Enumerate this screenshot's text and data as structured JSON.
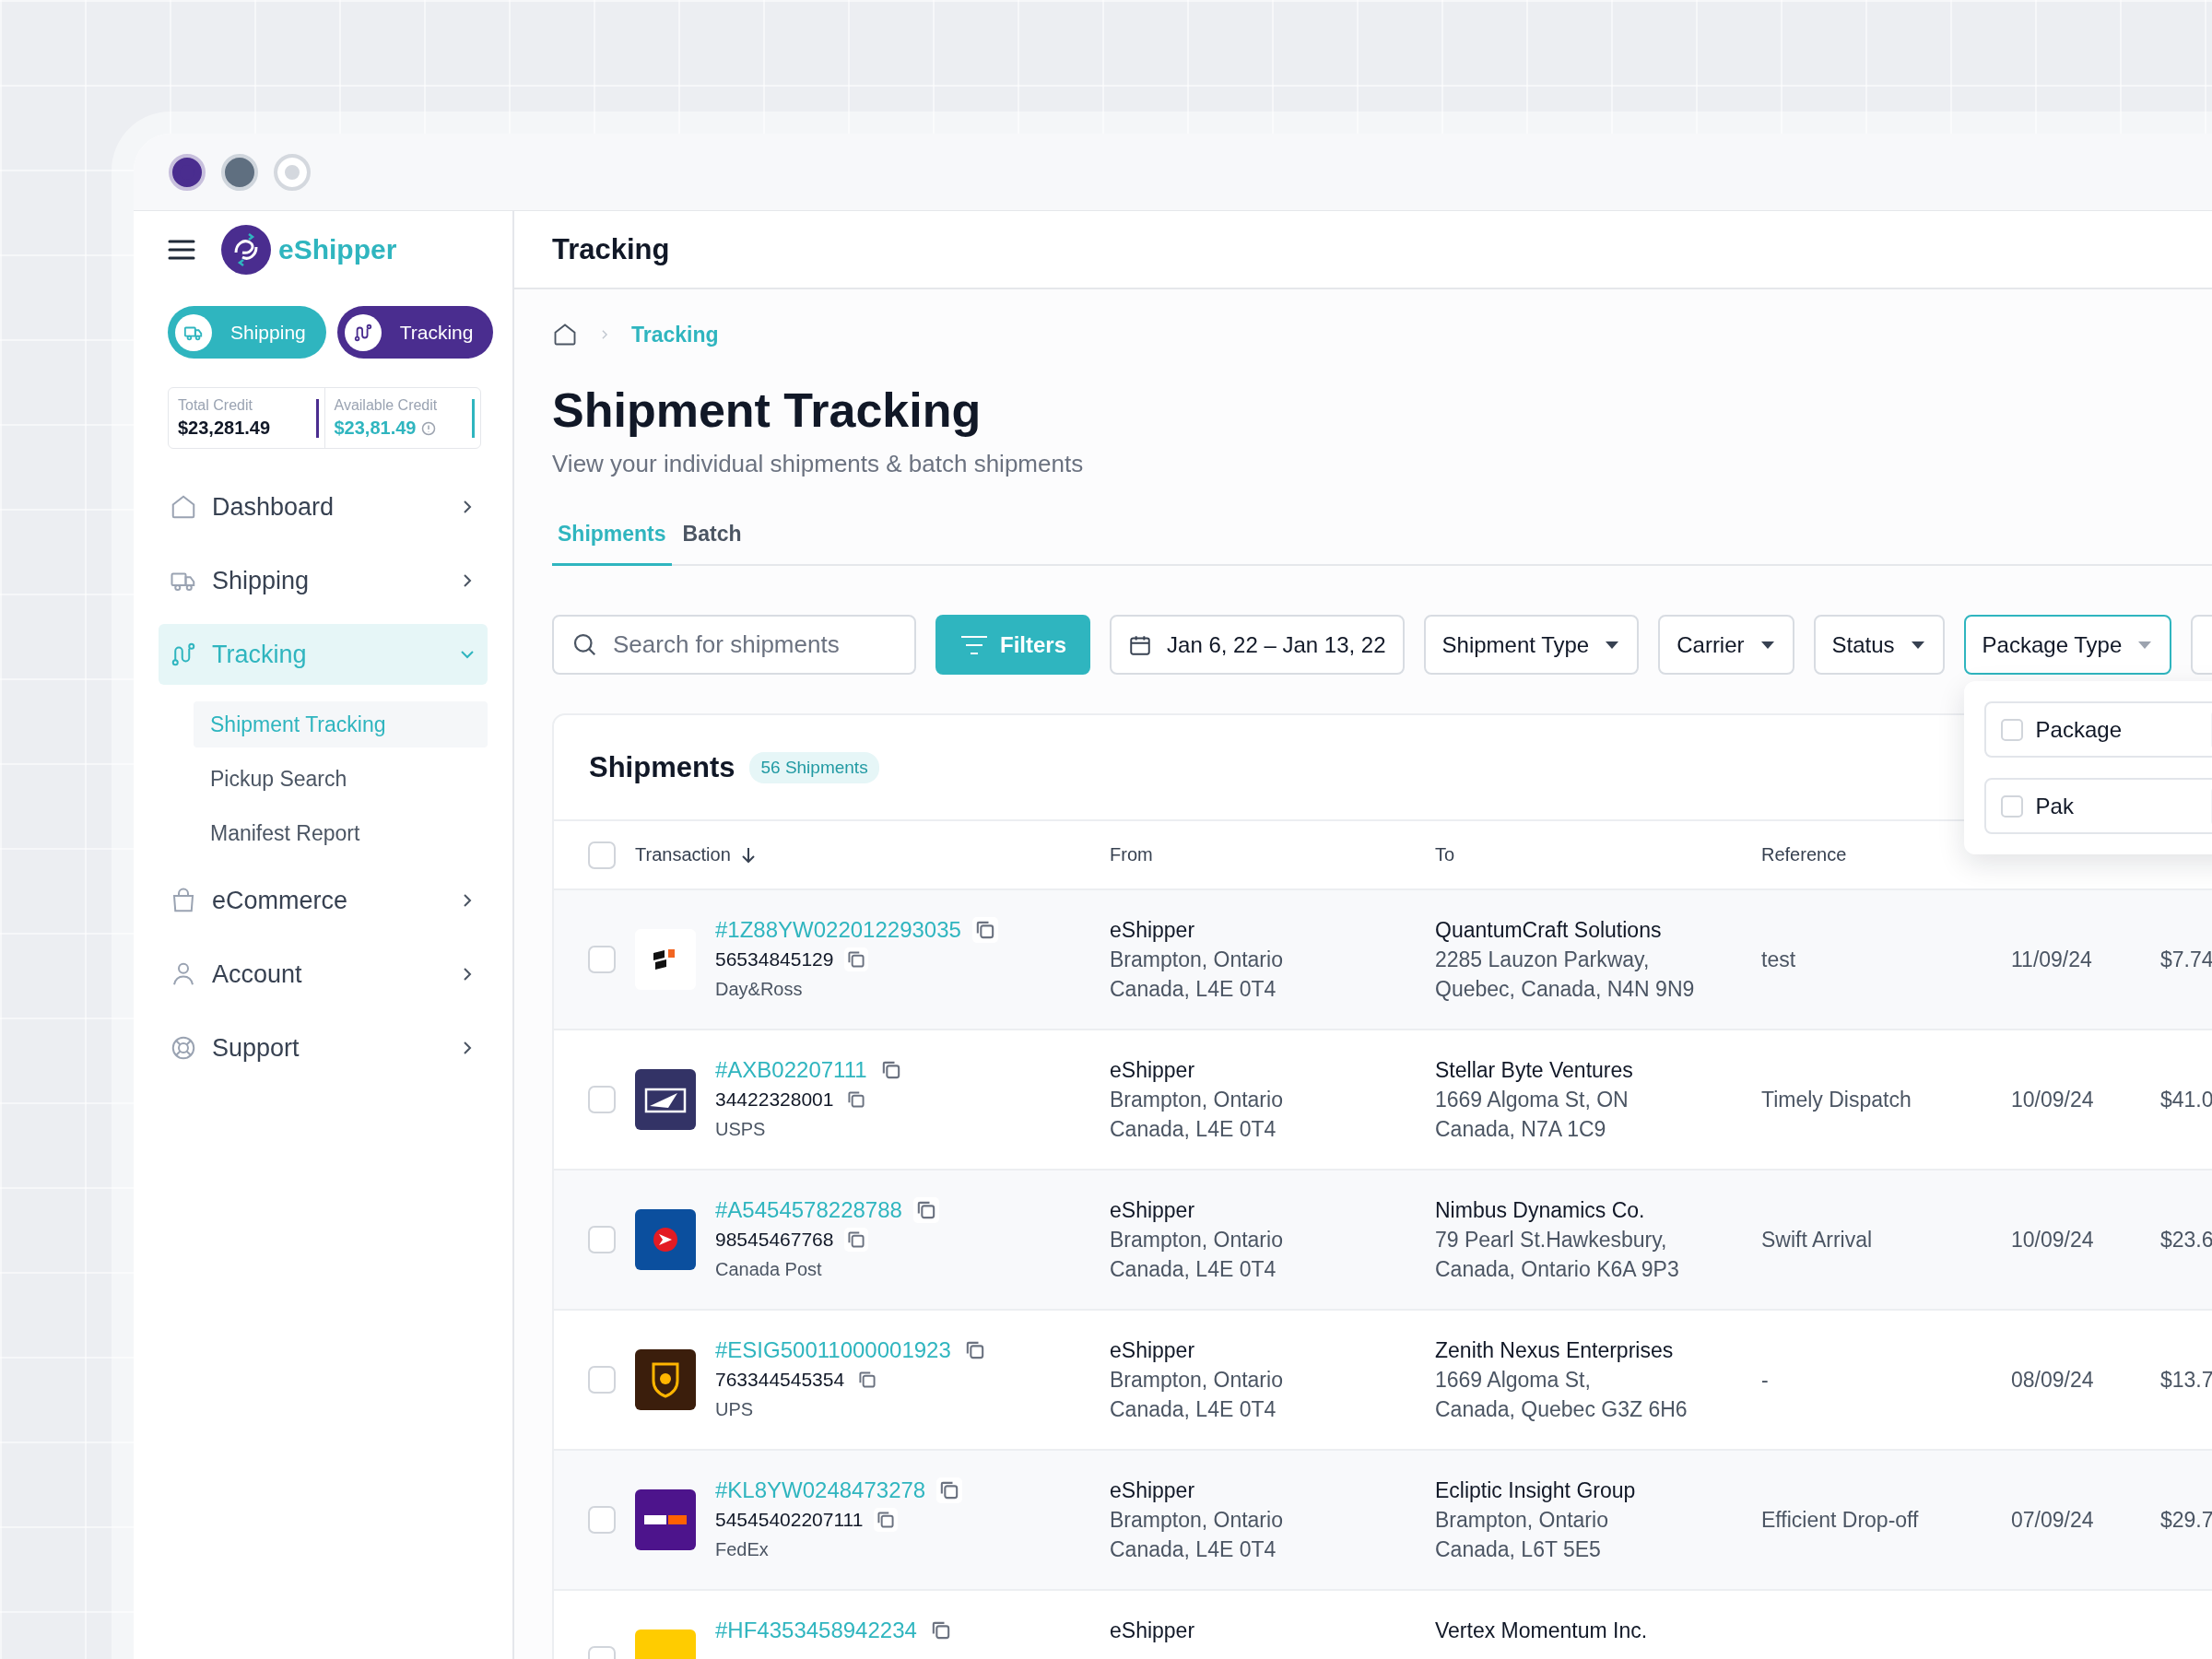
{
  "sidebar": {
    "brand": "eShipper",
    "quick_actions": [
      {
        "label": "Shipping",
        "color": "#2fb5bf"
      },
      {
        "label": "Tracking",
        "color": "#4a2d8f"
      }
    ],
    "credits": [
      {
        "label": "Total Credit",
        "value": "$23,281.49",
        "kind": "total"
      },
      {
        "label": "Available Credit",
        "value": "$23,81.49",
        "kind": "available"
      }
    ],
    "nav": [
      {
        "label": "Dashboard",
        "selected": false,
        "expanded": false
      },
      {
        "label": "Shipping",
        "selected": false,
        "expanded": false
      },
      {
        "label": "Tracking",
        "selected": true,
        "expanded": true,
        "children": [
          {
            "label": "Shipment Tracking",
            "selected": true
          },
          {
            "label": "Pickup Search",
            "selected": false
          },
          {
            "label": "Manifest Report",
            "selected": false
          }
        ]
      },
      {
        "label": "eCommerce",
        "selected": false,
        "expanded": false
      },
      {
        "label": "Account",
        "selected": false,
        "expanded": false
      },
      {
        "label": "Support",
        "selected": false,
        "expanded": false
      }
    ]
  },
  "header": {
    "title": "Tracking"
  },
  "breadcrumb": [
    {
      "label": "Tracking"
    }
  ],
  "page": {
    "title": "Shipment Tracking",
    "subtitle": "View your individual shipments & batch shipments"
  },
  "tabs": [
    {
      "label": "Shipments",
      "selected": true
    },
    {
      "label": "Batch",
      "selected": false
    }
  ],
  "filters": {
    "search": {
      "placeholder": "Search for shipments"
    },
    "filters_button": "Filters",
    "date_range": "Jan 6, 22 – Jan 13, 22",
    "dropdowns": [
      {
        "label": "Shipment Type",
        "open": false
      },
      {
        "label": "Carrier",
        "open": false
      },
      {
        "label": "Status",
        "open": false
      },
      {
        "label": "Package Type",
        "open": true
      }
    ],
    "menu_options": [
      {
        "label": "Package",
        "checked": false
      },
      {
        "label": "Pak",
        "checked": false
      }
    ]
  },
  "table": {
    "title": "Shipments",
    "count": "56 Shipments",
    "all_selected": false,
    "columns": [
      {
        "label": "Transaction",
        "sorted": true
      },
      {
        "label": "From"
      },
      {
        "label": "To"
      },
      {
        "label": "Reference"
      }
    ],
    "rows": [
      {
        "selected": false,
        "transaction": "#1Z88YW022012293035",
        "tracking": "56534845129",
        "carrier": "Day&Ross",
        "from": [
          "eShipper",
          "Brampton, Ontario",
          "Canada, L4E 0T4"
        ],
        "to": [
          "QuantumCraft Solutions",
          "2285 Lauzon Parkway,",
          "Quebec, Canada, N4N 9N9"
        ],
        "reference": "test",
        "ship_date": "11/09/24",
        "price": "$7.74"
      },
      {
        "selected": false,
        "transaction": "#AXB02207111",
        "tracking": "34422328001",
        "carrier": "USPS",
        "from": [
          "eShipper",
          "Brampton, Ontario",
          "Canada, L4E 0T4"
        ],
        "to": [
          "Stellar Byte Ventures",
          "1669 Algoma St, ON",
          "Canada, N7A 1C9"
        ],
        "reference": "Timely Dispatch",
        "ship_date": "10/09/24",
        "price": "$41.0"
      },
      {
        "selected": false,
        "transaction": "#A5454578228788",
        "tracking": "98545467768",
        "carrier": "Canada Post",
        "from": [
          "eShipper",
          "Brampton, Ontario",
          "Canada, L4E 0T4"
        ],
        "to": [
          "Nimbus Dynamics Co.",
          "79 Pearl St.Hawkesbury,",
          "Canada, Ontario K6A 9P3"
        ],
        "reference": "Swift Arrival",
        "ship_date": "10/09/24",
        "price": "$23.6"
      },
      {
        "selected": false,
        "transaction": "#ESIG50011000001923",
        "tracking": "763344545354",
        "carrier": "UPS",
        "from": [
          "eShipper",
          "Brampton, Ontario",
          "Canada, L4E 0T4"
        ],
        "to": [
          "Zenith Nexus Enterprises",
          "1669 Algoma St,",
          "Canada, Quebec G3Z 6H6"
        ],
        "reference": "-",
        "ship_date": "08/09/24",
        "price": "$13.7"
      },
      {
        "selected": false,
        "transaction": "#KL8YW0248473278",
        "tracking": "54545402207111",
        "carrier": "FedEx",
        "from": [
          "eShipper",
          "Brampton, Ontario",
          "Canada, L4E 0T4"
        ],
        "to": [
          "Ecliptic Insight Group",
          "Brampton, Ontario",
          "Canada, L6T 5E5"
        ],
        "reference": "Efficient Drop-off",
        "ship_date": "07/09/24",
        "price": "$29.7"
      },
      {
        "selected": false,
        "transaction": "#HF4353458942234",
        "from": [
          "eShipper"
        ],
        "to": [
          "Vertex Momentum Inc."
        ]
      }
    ]
  }
}
